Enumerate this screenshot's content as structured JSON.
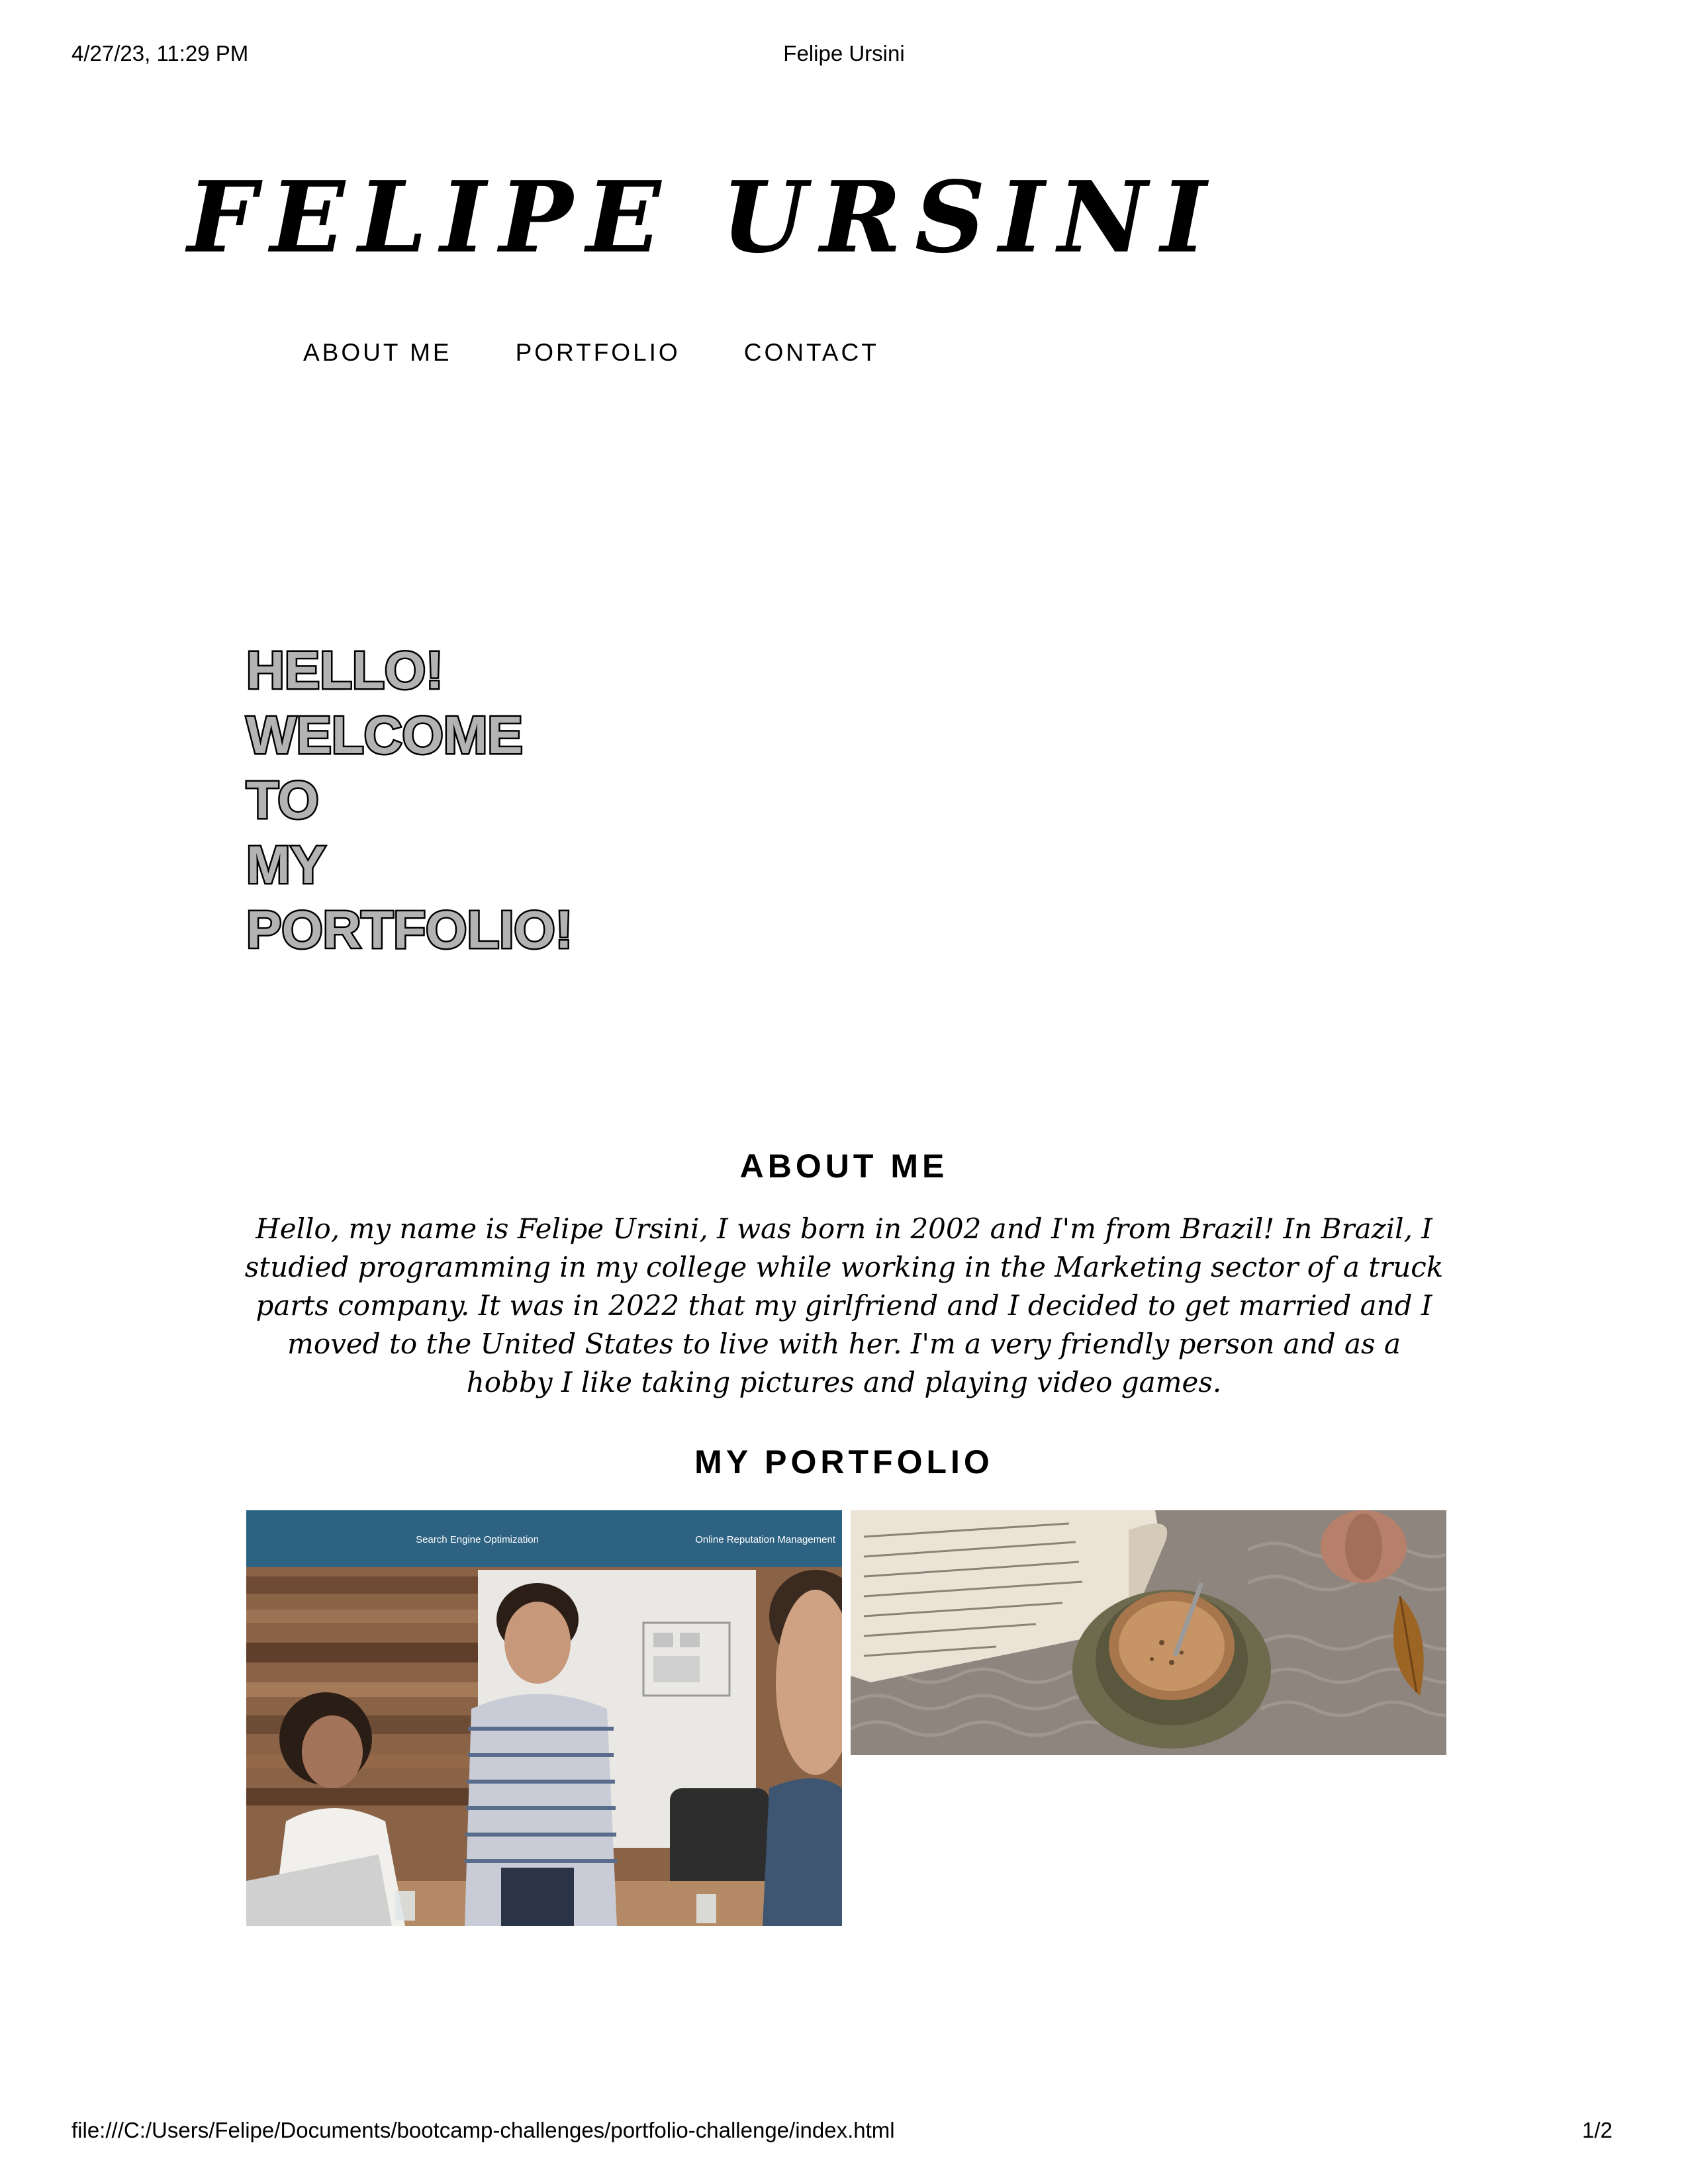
{
  "print_header": {
    "date": "4/27/23, 11:29 PM",
    "title": "Felipe Ursini"
  },
  "site": {
    "title": "FELIPE URSINI"
  },
  "nav": {
    "items": [
      "ABOUT ME",
      "PORTFOLIO",
      "CONTACT"
    ]
  },
  "hero": {
    "lines": [
      "HELLO!",
      "WELCOME",
      "TO",
      "MY",
      "PORTFOLIO!"
    ]
  },
  "about": {
    "heading": "ABOUT ME",
    "text": "Hello, my name is Felipe Ursini, I was born in 2002 and I'm from Brazil! In Brazil, I studied programming in my college while working in the Marketing sector of a truck parts company. It was in 2022 that my girlfriend and I decided to get married and I moved to the United States to live with her. I'm a very friendly person and as a hobby I like taking pictures and playing video games."
  },
  "portfolio": {
    "heading": "MY PORTFOLIO",
    "projects": [
      {
        "nav_links": [
          "Search Engine Optimization",
          "Online Reputation Management"
        ]
      },
      {}
    ]
  },
  "print_footer": {
    "url": "file:///C:/Users/Felipe/Documents/bootcamp-challenges/portfolio-challenge/index.html",
    "page": "1/2"
  },
  "colors": {
    "text": "#000000",
    "background": "#ffffff",
    "hero_fill": "#b3b3b3",
    "project_banner": "#2e6282"
  }
}
